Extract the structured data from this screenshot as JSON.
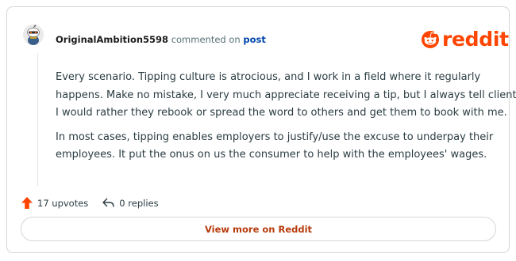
{
  "comment": {
    "username": "OriginalAmbition5598",
    "action_text": "commented on",
    "post_link": "post",
    "paragraphs": [
      "Every scenario. Tipping culture is atrocious, and I work in a field where it regularly",
      "happens. Make no mistake, I very much appreciate receiving a tip, but I always tell clients",
      "I would rather they rebook or spread the word to others and get them to book with me.",
      "In most cases, tipping enables employers to justify/use the excuse to underpay their",
      "employees. It put the onus on us the consumer to help with the employees' wages."
    ],
    "upvotes": "17 upvotes",
    "replies": "0 replies",
    "view_more": "View more on Reddit"
  },
  "brand": {
    "logo_text": "reddit",
    "logo_color": "#ff4500",
    "icons": [
      "snoo-avatar-icon",
      "reddit-logo-icon",
      "upvote-arrow-icon",
      "reply-icon"
    ]
  }
}
